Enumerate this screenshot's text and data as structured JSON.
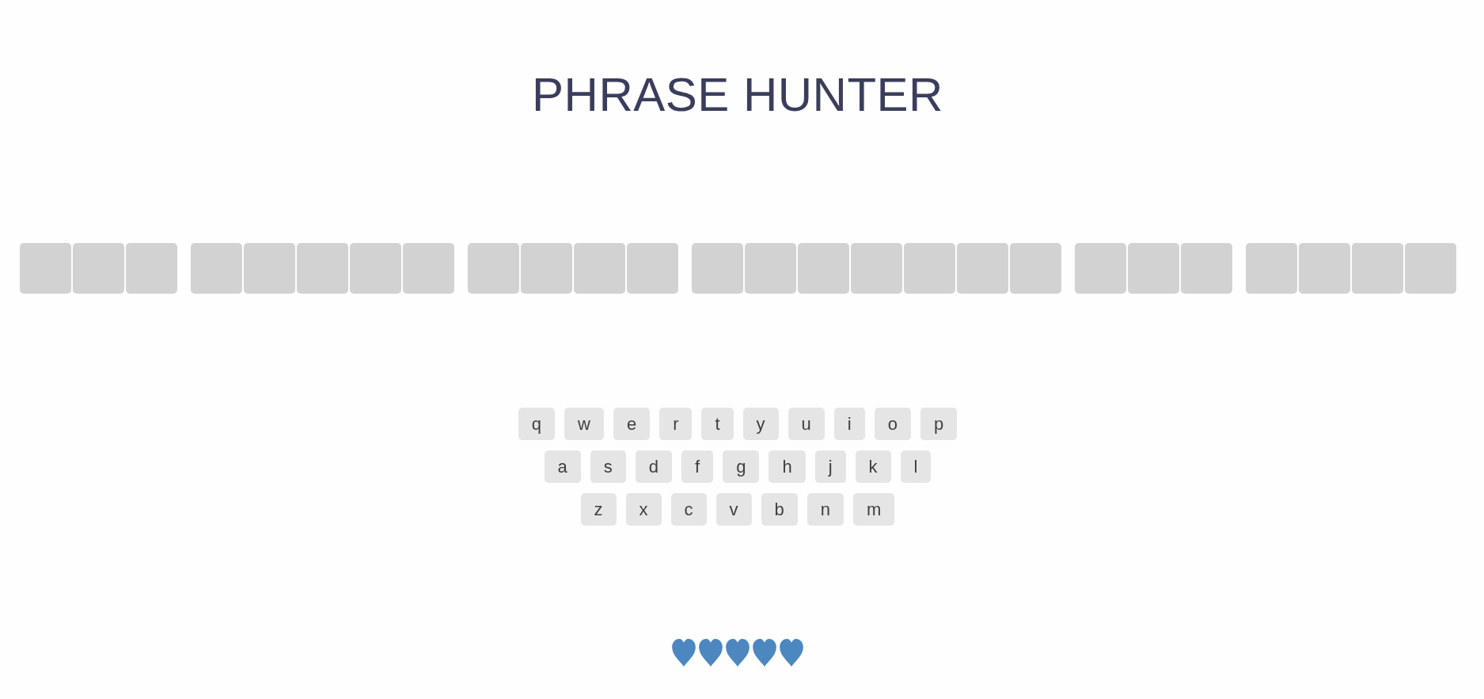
{
  "title": "PHRASE HUNTER",
  "phrase": {
    "words": [
      {
        "letters": [
          {
            "revealed": false
          },
          {
            "revealed": false
          },
          {
            "revealed": false
          }
        ]
      },
      {
        "letters": [
          {
            "revealed": false
          },
          {
            "revealed": false
          },
          {
            "revealed": false
          },
          {
            "revealed": false
          },
          {
            "revealed": false
          }
        ]
      },
      {
        "letters": [
          {
            "revealed": false
          },
          {
            "revealed": false
          },
          {
            "revealed": false
          },
          {
            "revealed": false
          }
        ]
      },
      {
        "letters": [
          {
            "revealed": false
          },
          {
            "revealed": false
          },
          {
            "revealed": false
          },
          {
            "revealed": false
          },
          {
            "revealed": false
          },
          {
            "revealed": false
          },
          {
            "revealed": false
          }
        ]
      },
      {
        "letters": [
          {
            "revealed": false
          },
          {
            "revealed": false
          },
          {
            "revealed": false
          }
        ]
      },
      {
        "letters": [
          {
            "revealed": false
          },
          {
            "revealed": false
          },
          {
            "revealed": false
          },
          {
            "revealed": false
          }
        ]
      }
    ]
  },
  "keyboard": {
    "rows": [
      {
        "keys": [
          {
            "label": "q"
          },
          {
            "label": "w"
          },
          {
            "label": "e"
          },
          {
            "label": "r"
          },
          {
            "label": "t"
          },
          {
            "label": "y"
          },
          {
            "label": "u"
          },
          {
            "label": "i"
          },
          {
            "label": "o"
          },
          {
            "label": "p"
          }
        ]
      },
      {
        "keys": [
          {
            "label": "a"
          },
          {
            "label": "s"
          },
          {
            "label": "d"
          },
          {
            "label": "f"
          },
          {
            "label": "g"
          },
          {
            "label": "h"
          },
          {
            "label": "j"
          },
          {
            "label": "k"
          },
          {
            "label": "l"
          }
        ]
      },
      {
        "keys": [
          {
            "label": "z"
          },
          {
            "label": "x"
          },
          {
            "label": "c"
          },
          {
            "label": "v"
          },
          {
            "label": "b"
          },
          {
            "label": "n"
          },
          {
            "label": "m"
          }
        ]
      }
    ]
  },
  "scoreboard": {
    "lives": [
      {
        "lost": false
      },
      {
        "lost": false
      },
      {
        "lost": false
      },
      {
        "lost": false
      },
      {
        "lost": false
      }
    ]
  }
}
